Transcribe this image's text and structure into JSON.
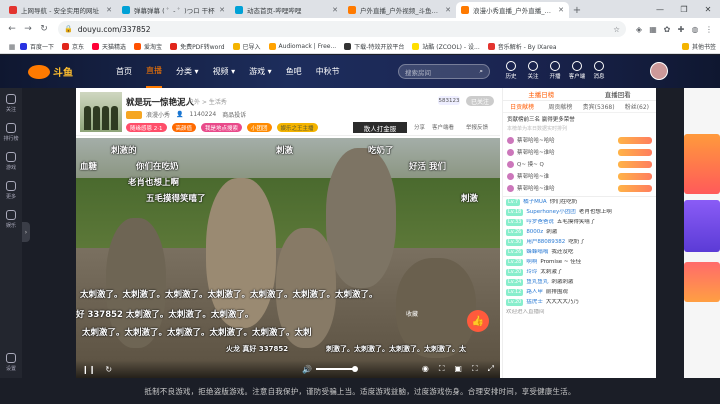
{
  "browser": {
    "tabs": [
      {
        "label": "上网导航 - 安全实用的网址",
        "color": "#e3342f"
      },
      {
        "label": "弹幕弹幕 ( ゜- ゜)つロ 干杯",
        "color": "#00a1d6"
      },
      {
        "label": "动态首页-哔哩哔哩",
        "color": "#00a1d6"
      },
      {
        "label": "户外直播_户外视频_斗鱼直播",
        "color": "#ff7a00"
      },
      {
        "label": "浪漫小秀直播_户外直播_户外",
        "color": "#ff7a00"
      }
    ],
    "new_tab": "+",
    "url": "douyu.com/337852",
    "bookmarks": [
      {
        "label": "百度一下",
        "color": "#2932e1"
      },
      {
        "label": "京东",
        "color": "#e1251b"
      },
      {
        "label": "天猫精选",
        "color": "#ff0036"
      },
      {
        "label": "爱淘宝",
        "color": "#ff5000"
      },
      {
        "label": "免费PDF转word",
        "color": "#e1251b"
      },
      {
        "label": "已导入",
        "color": "#f4b400"
      },
      {
        "label": "Audiomack | Free...",
        "color": "#ffa200"
      },
      {
        "label": "下载-特效开放平台",
        "color": "#333333"
      },
      {
        "label": "站酷 (ZCOOL) - 设...",
        "color": "#ffde00"
      },
      {
        "label": "音乐解析 - By IXarea",
        "color": "#e3342f"
      }
    ],
    "bookmarks_other": "其他书签"
  },
  "site": {
    "logo": "斗鱼",
    "nav": [
      "首页",
      "直播",
      "分类 ▾",
      "视频 ▾",
      "游戏 ▾",
      "鱼吧",
      "中秋节"
    ],
    "active_nav": "直播",
    "search_placeholder": "搜索房间",
    "header_icons": [
      "历史",
      "关注",
      "开播",
      "客户端",
      "消息"
    ]
  },
  "left_rail": [
    "关注",
    "排行榜",
    "游戏",
    "更多",
    "娱乐",
    "设置"
  ],
  "room": {
    "title": "就是玩一惊艳泥人",
    "category": "户外 > 生活秀",
    "anchor": "浪漫小秀",
    "followers": "1140224",
    "report": "商品投诉",
    "viewers": "583123",
    "follow": "已关注",
    "tags": [
      "随缘感恩 2·1",
      "高颜值",
      "我是地点搜索",
      "小团团",
      "娱乐之王主播"
    ],
    "game_button": "散人打金服",
    "mini_actions": [
      "分享",
      "客户端看",
      "举报反馈"
    ],
    "collect": "收藏"
  },
  "danmu": [
    "刺激的",
    "刺激",
    "吃奶了",
    "你们在吃奶",
    "血糖",
    "老肖也想上啊",
    "好活 我们",
    "五毛摸得笑嘻了",
    "刺激",
    "太刺激了。太刺激了。太刺激了。太刺激了。太刺激了。太刺激了。太刺激了。",
    "太刺激了。太刺激了。太刺激了。太刺激了。太刺激了。太刺",
    "好 337852 太刺激了。太刺激了。太刺激了。",
    "火龙 真好 337852",
    "刺激了。太刺激了。太刺激了。太刺激了。太"
  ],
  "player": {
    "controls": [
      "❙❙",
      "↻",
      "🔊"
    ],
    "right_controls": [
      "◉",
      "⛶",
      "▣",
      "⛶",
      "⤢"
    ]
  },
  "sidepanel": {
    "tabs": [
      "主播日榜",
      "直播回看"
    ],
    "subtabs": [
      "日贡献榜",
      "周贡献榜",
      "贵宾(5368)",
      "粉丝(62)"
    ],
    "rank_title": "贡献榜前三名 赢得更多荣誉",
    "rank_sub": "本榜单为本日数据实时排列",
    "rank_rows": [
      "蔡邨哈哈~哈哈",
      "蔡邨哈哈~谁哈",
      "Q~ 摸~ Q",
      "蔡邨哈哈~谁",
      "蔡邨哈哈~谁哈"
    ],
    "messages": [
      {
        "lv": "Lv.7",
        "user": "橘子MUA",
        "text": "你们在吃奶"
      },
      {
        "lv": "Lv.18",
        "user": "Superhoney小团团",
        "text": "老肖也想上啊"
      },
      {
        "lv": "Lv.33",
        "user": "哼罗爸爸说",
        "text": "五毛摸得笑嘻了"
      },
      {
        "lv": "Lv.26",
        "user": "8000z",
        "text": "刺激"
      },
      {
        "lv": "Lv.30",
        "user": "用户88089382",
        "text": "吃奶了"
      },
      {
        "lv": "Lv.26",
        "user": "蜂蜂嗡嗡",
        "text": "我还没吃"
      },
      {
        "lv": "Lv.28",
        "user": "啊啊",
        "text": "Promise ~ 佳佳"
      },
      {
        "lv": "Lv.20",
        "user": "玲玲",
        "text": "太刺激了"
      },
      {
        "lv": "Lv.24",
        "user": "鱼丸鱼丸",
        "text": "刺激刺激"
      },
      {
        "lv": "Lv.12",
        "user": "路人甲",
        "text": "前排围观"
      },
      {
        "lv": "Lv.20",
        "user": "猛虎士",
        "text": "大大大大乃乃"
      },
      {
        "lv": "",
        "user": "",
        "text": "欢迎进入直播间"
      }
    ]
  },
  "footer": "抵制不良游戏，拒绝盗版游戏。注意自我保护，谨防受骗上当。适度游戏益脑，过度游戏伤身。合理安排时间，享受健康生活。"
}
